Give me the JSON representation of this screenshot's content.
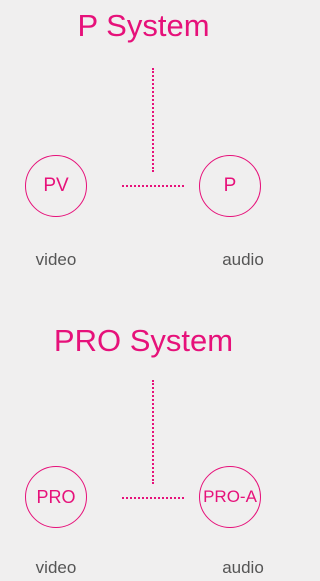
{
  "diagrams": [
    {
      "title": "P System",
      "left_node": {
        "label": "PV",
        "caption": "video"
      },
      "right_node": {
        "label": "P",
        "caption": "audio"
      }
    },
    {
      "title": "PRO System",
      "left_node": {
        "label": "PRO",
        "caption": "video"
      },
      "right_node": {
        "label": "PRO-A",
        "caption": "audio"
      }
    }
  ],
  "colors": {
    "accent": "#e6117a",
    "caption_text": "#555555",
    "background": "#f0efef"
  }
}
